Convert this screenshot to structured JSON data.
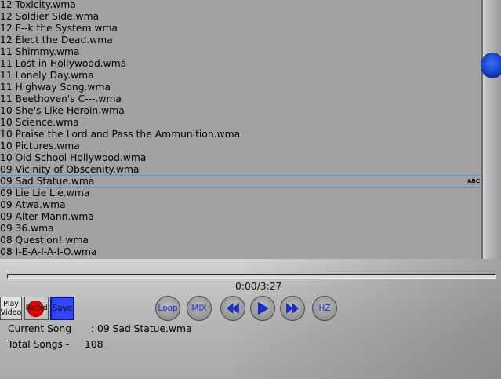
{
  "playlist": {
    "tracks": [
      {
        "title": "12 Toxicity.wma"
      },
      {
        "title": "12 Soldier Side.wma"
      },
      {
        "title": "12 F--k the System.wma"
      },
      {
        "title": "12 Elect the Dead.wma"
      },
      {
        "title": "11 Shimmy.wma"
      },
      {
        "title": "11 Lost in Hollywood.wma"
      },
      {
        "title": "11 Lonely Day.wma"
      },
      {
        "title": "11 Highway Song.wma"
      },
      {
        "title": "11 Beethoven's C---.wma"
      },
      {
        "title": "10 She's Like Heroin.wma"
      },
      {
        "title": "10 Science.wma"
      },
      {
        "title": "10 Praise the Lord and Pass the Ammunition.wma"
      },
      {
        "title": "10 Pictures.wma"
      },
      {
        "title": "10 Old School Hollywood.wma"
      },
      {
        "title": "09 Vicinity of Obscenity.wma"
      },
      {
        "title": "09 Sad Statue.wma",
        "selected": true,
        "tag": "ABC"
      },
      {
        "title": "09 Lie Lie Lie.wma"
      },
      {
        "title": "09 Atwa.wma"
      },
      {
        "title": "09 Alter Mann.wma"
      },
      {
        "title": "09 36.wma"
      },
      {
        "title": "08 Question!.wma"
      },
      {
        "title": "08 I-E-A-I-A-I-O.wma"
      }
    ]
  },
  "player": {
    "time_display": "0:00/3:27",
    "progress_fraction": 0.0,
    "buttons": {
      "play_video": "Play Video",
      "record": "Record",
      "save": "Save",
      "loop": "Loop",
      "mix": "MIX",
      "hz": "HZ"
    },
    "icons": {
      "rewind": "rewind-icon",
      "play": "play-icon",
      "fast_forward": "fast-forward-icon"
    },
    "current_song_label": "Current Song",
    "current_song_value": ": 09 Sad Statue.wma",
    "total_songs_label": "Total Songs -",
    "total_songs_value": "108"
  },
  "colors": {
    "accent_blue": "#1a2fd8",
    "record_red": "#e00000",
    "save_blue": "#2f45ff",
    "selection_border": "#4aa0e6"
  }
}
